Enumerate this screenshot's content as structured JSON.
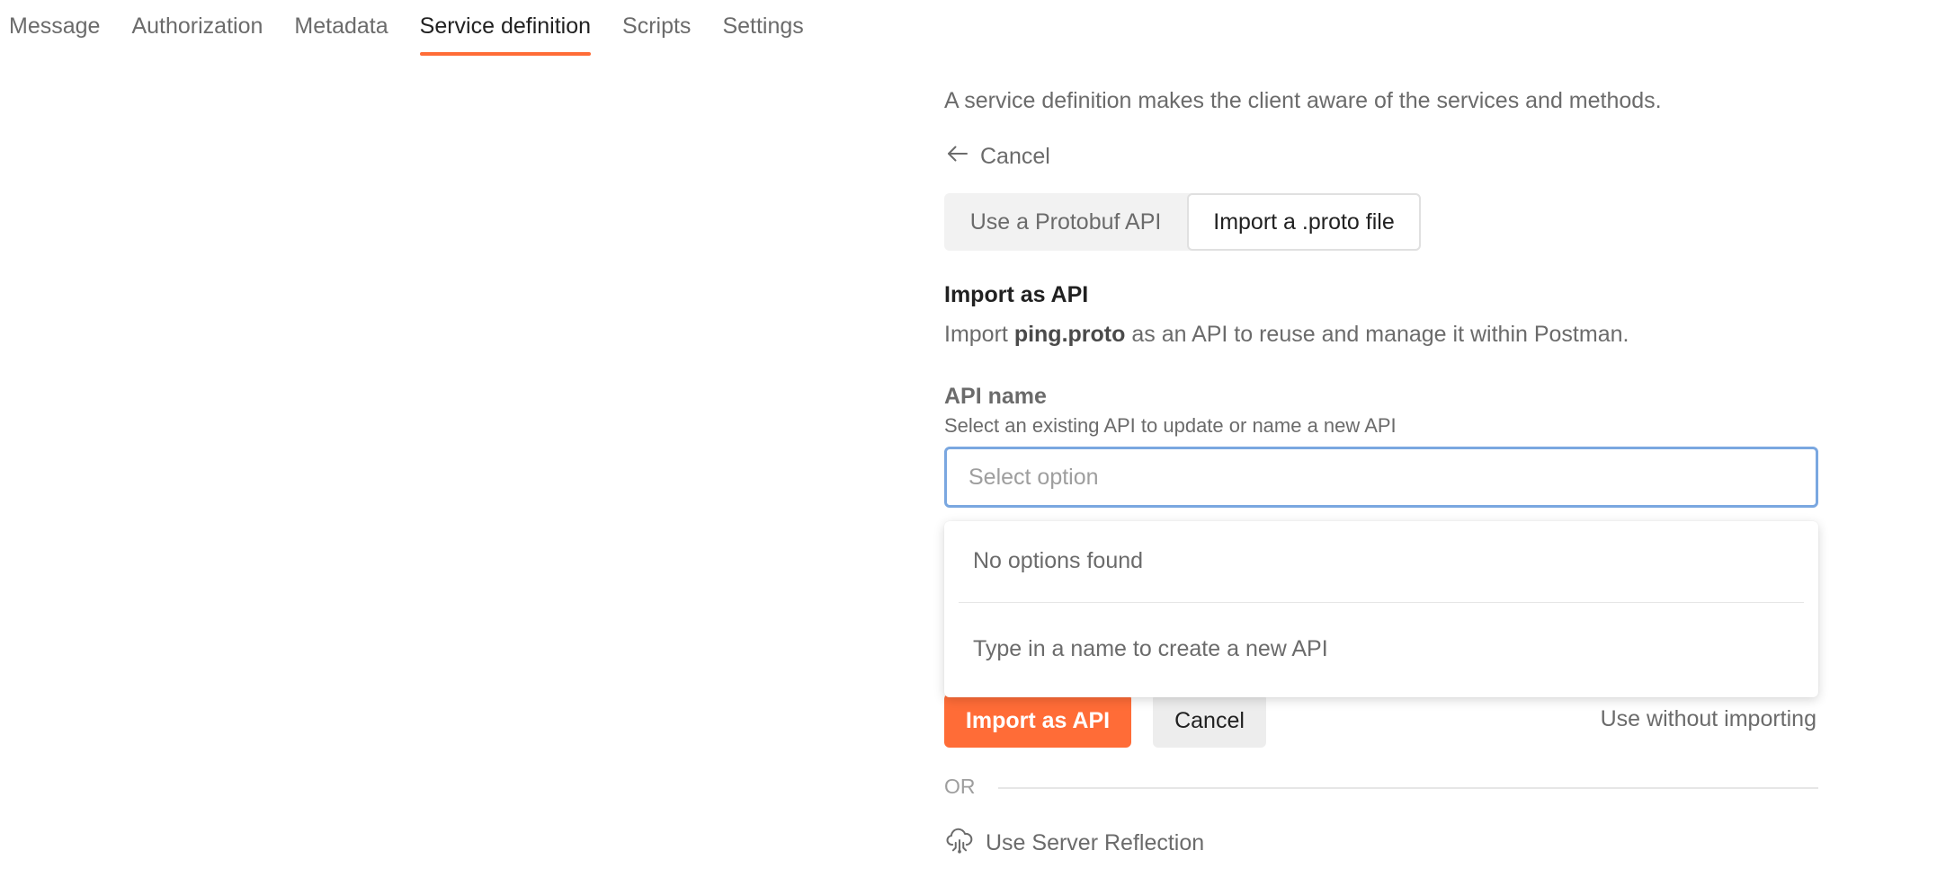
{
  "tabs": [
    {
      "label": "Message"
    },
    {
      "label": "Authorization"
    },
    {
      "label": "Metadata"
    },
    {
      "label": "Service definition",
      "active": true
    },
    {
      "label": "Scripts"
    },
    {
      "label": "Settings"
    }
  ],
  "description": "A service definition makes the client aware of the services and methods.",
  "back": {
    "label": "Cancel",
    "icon": "arrow-left-icon"
  },
  "source_toggle": {
    "option_a": "Use a Protobuf API",
    "option_b": "Import a .proto file",
    "selected": "Import a .proto file"
  },
  "import_section": {
    "heading": "Import as API",
    "text_prefix": "Import",
    "file_name": "ping.proto",
    "text_suffix": "as an API to reuse and manage it within Postman."
  },
  "api_name": {
    "label": "API name",
    "hint": "Select an existing API to update or name a new API",
    "placeholder": "Select option",
    "value": ""
  },
  "dropdown": {
    "empty_message": "No options found",
    "create_hint": "Type in a name to create a new API"
  },
  "actions": {
    "import_label": "Import as API",
    "cancel_label": "Cancel",
    "use_without_label": "Use without importing"
  },
  "divider_label": "OR",
  "reflection": {
    "label": "Use Server Reflection",
    "icon": "cloud-reflection-icon"
  },
  "colors": {
    "accent": "#ff6c37",
    "focus_border": "#7aa7e0",
    "text_primary": "#212121",
    "text_secondary": "#6b6b6b"
  }
}
